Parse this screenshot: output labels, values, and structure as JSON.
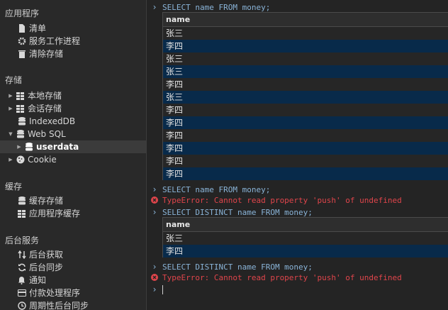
{
  "sidebar": {
    "sections": [
      {
        "title": "应用程序",
        "items": [
          {
            "label": "清单",
            "icon": "document-icon"
          },
          {
            "label": "服务工作进程",
            "icon": "gear-icon"
          },
          {
            "label": "清除存储",
            "icon": "trash-icon"
          }
        ]
      },
      {
        "title": "存储",
        "items": [
          {
            "label": "本地存储",
            "icon": "grid-icon"
          },
          {
            "label": "会话存储",
            "icon": "grid-icon"
          },
          {
            "label": "IndexedDB",
            "icon": "database-icon"
          },
          {
            "label": "Web SQL",
            "icon": "database-icon"
          },
          {
            "label": "userdata",
            "icon": "database-icon"
          },
          {
            "label": "Cookie",
            "icon": "cookie-icon"
          }
        ]
      },
      {
        "title": "缓存",
        "items": [
          {
            "label": "缓存存储",
            "icon": "database-icon"
          },
          {
            "label": "应用程序缓存",
            "icon": "grid-icon"
          }
        ]
      },
      {
        "title": "后台服务",
        "items": [
          {
            "label": "后台获取",
            "icon": "arrows-updown-icon"
          },
          {
            "label": "后台同步",
            "icon": "sync-icon"
          },
          {
            "label": "通知",
            "icon": "bell-icon"
          },
          {
            "label": "付款处理程序",
            "icon": "card-icon"
          },
          {
            "label": "周期性后台同步",
            "icon": "clock-icon"
          }
        ]
      }
    ]
  },
  "console": {
    "cmd1": "SELECT name FROM money;",
    "table1": {
      "header": "name",
      "rows": [
        "张三",
        "李四",
        "张三",
        "张三",
        "李四",
        "张三",
        "李四",
        "李四",
        "李四",
        "李四",
        "李四",
        "李四"
      ]
    },
    "cmd2": "SELECT name FROM money;",
    "err1": "TypeError: Cannot read property 'push' of undefined",
    "cmd3": "SELECT DISTINCT name FROM money;",
    "table2": {
      "header": "name",
      "rows": [
        "张三",
        "李四"
      ]
    },
    "cmd4": "SELECT DISTINCT name FROM money;",
    "err2": "TypeError: Cannot read property 'push' of undefined"
  },
  "colors": {
    "command": "#8ab4d8",
    "error": "#e0454b",
    "row_highlight": "#082a4a",
    "background": "#242424"
  }
}
